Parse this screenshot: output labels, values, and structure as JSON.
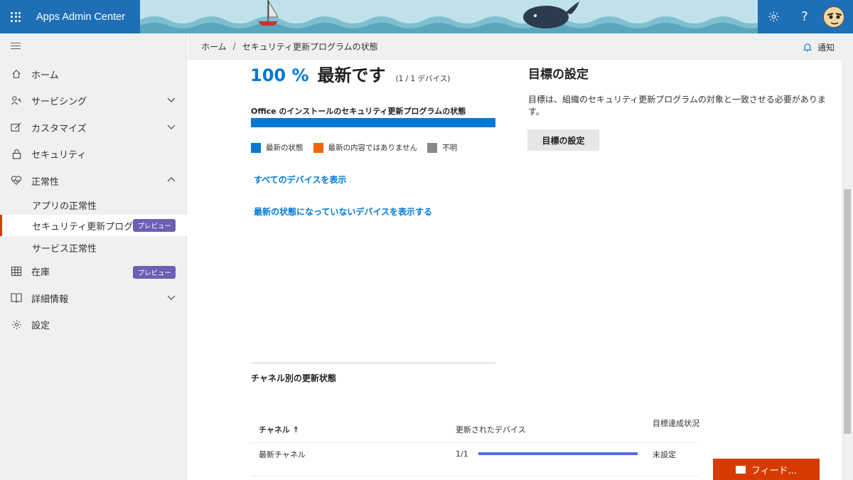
{
  "header": {
    "app_title": "Apps Admin Center",
    "icons": [
      "waffle-icon",
      "gear-icon",
      "help-icon",
      "avatar"
    ],
    "help_glyph": "?"
  },
  "sidebar": {
    "items": [
      {
        "label": "ホーム",
        "icon": "home-icon"
      },
      {
        "label": "サービシング",
        "icon": "servicing-icon",
        "expandable": true
      },
      {
        "label": "カスタマイズ",
        "icon": "customize-icon",
        "expandable": true
      },
      {
        "label": "セキュリティ",
        "icon": "lock-icon"
      },
      {
        "label": "正常性",
        "icon": "heart-icon",
        "expanded": true
      }
    ],
    "subitems": [
      {
        "label": "アプリの正常性"
      },
      {
        "label": "セキュリティ更新プログラム...",
        "badge": "プレビュー",
        "active": true
      },
      {
        "label": "サービス正常性"
      }
    ],
    "items_after": [
      {
        "label": "在庫",
        "icon": "table-icon",
        "badge": "プレビュー"
      },
      {
        "label": "詳細情報",
        "icon": "book-icon",
        "expandable": true
      },
      {
        "label": "設定",
        "icon": "gear-icon"
      }
    ]
  },
  "breadcrumb": {
    "home": "ホーム",
    "separator": "/",
    "current": "セキュリティ更新プログラムの状態",
    "notification": "通知"
  },
  "status": {
    "percent": "100 %",
    "state": "最新です",
    "devices": "(1 / 1 デバイス)",
    "section_label": "Office のインストールのセキュリティ更新プログラムの状態",
    "up_to_date_fraction": 1.0,
    "legend": [
      {
        "label": "最新の状態",
        "color": "#0078d4"
      },
      {
        "label": "最新の内容ではありません",
        "color": "#f7630c"
      },
      {
        "label": "不明",
        "color": "#8a8886"
      }
    ]
  },
  "links": {
    "all_devices": "すべてのデバイスを表示",
    "not_up_to_date": "最新の状態になっていないデバイスを表示する"
  },
  "goal": {
    "title": "目標の設定",
    "description": "目標は、組織のセキュリティ更新プログラムの対象と一致させる必要があります。",
    "button": "目標の設定"
  },
  "channel": {
    "title": "チャネル別の更新状態",
    "columns": [
      "チャネル ↑",
      "更新されたデバイス",
      "目標達成状況"
    ],
    "rows": [
      {
        "channel": "最新チャネル",
        "updated": "1/1",
        "fraction": 1.0,
        "goal": "未設定"
      }
    ]
  },
  "feedback": {
    "label": "フィード..."
  },
  "colors": {
    "accent": "#0078d4",
    "brand_bar": "#1e6fb6",
    "feedback": "#d83b01",
    "badge": "#6b5fb5"
  }
}
